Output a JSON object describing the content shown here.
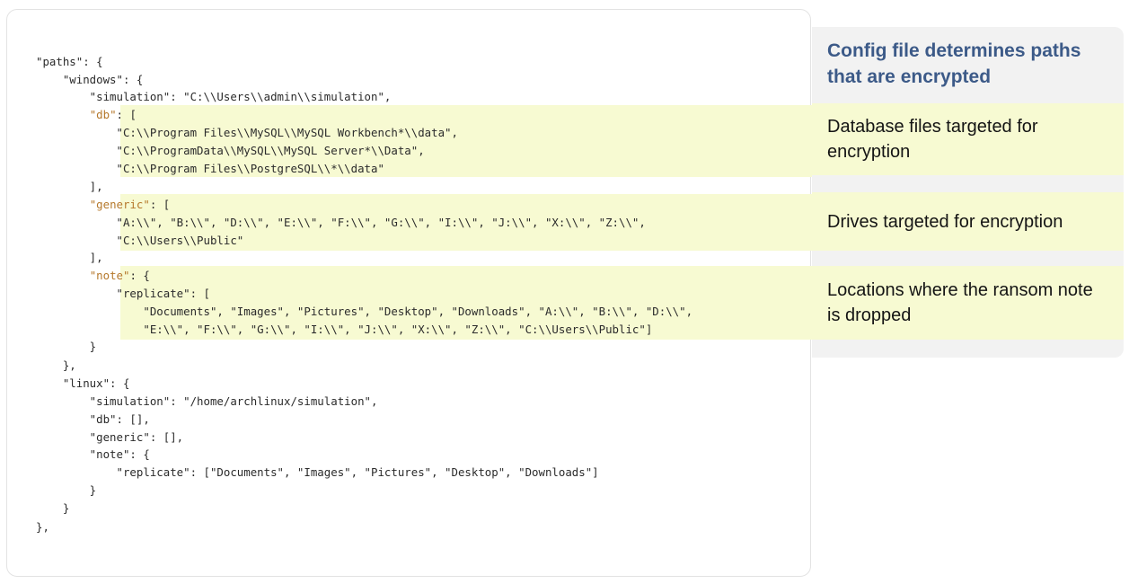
{
  "code": {
    "lines": [
      "\"paths\": {",
      "    \"windows\": {",
      "        \"simulation\": \"C:\\\\Users\\\\admin\\\\simulation\",",
      "        \"db\": [",
      "            \"C:\\\\Program Files\\\\MySQL\\\\MySQL Workbench*\\\\data\",",
      "            \"C:\\\\ProgramData\\\\MySQL\\\\MySQL Server*\\\\Data\",",
      "            \"C:\\\\Program Files\\\\PostgreSQL\\\\*\\\\data\"",
      "        ],",
      "        \"generic\": [",
      "            \"A:\\\\\", \"B:\\\\\", \"D:\\\\\", \"E:\\\\\", \"F:\\\\\", \"G:\\\\\", \"I:\\\\\", \"J:\\\\\", \"X:\\\\\", \"Z:\\\\\",",
      "            \"C:\\\\Users\\\\Public\"",
      "        ],",
      "        \"note\": {",
      "            \"replicate\": [",
      "                \"Documents\", \"Images\", \"Pictures\", \"Desktop\", \"Downloads\", \"A:\\\\\", \"B:\\\\\", \"D:\\\\\",",
      "                \"E:\\\\\", \"F:\\\\\", \"G:\\\\\", \"I:\\\\\", \"J:\\\\\", \"X:\\\\\", \"Z:\\\\\", \"C:\\\\Users\\\\Public\"]",
      "        }",
      "    },",
      "    \"linux\": {",
      "        \"simulation\": \"/home/archlinux/simulation\",",
      "        \"db\": [],",
      "        \"generic\": [],",
      "        \"note\": {",
      "            \"replicate\": [\"Documents\", \"Images\", \"Pictures\", \"Desktop\", \"Downloads\"]",
      "        }",
      "    }",
      "},"
    ]
  },
  "sidebar": {
    "title": "Config file determines paths that are encrypted",
    "notes": {
      "db": "Database files targeted for encryption",
      "generic": "Drives targeted for encryption",
      "note": "Locations where the ransom note is dropped"
    }
  },
  "colors": {
    "highlight": "#f7fad2",
    "title": "#3c5a88",
    "panel": "#f2f2f2"
  }
}
